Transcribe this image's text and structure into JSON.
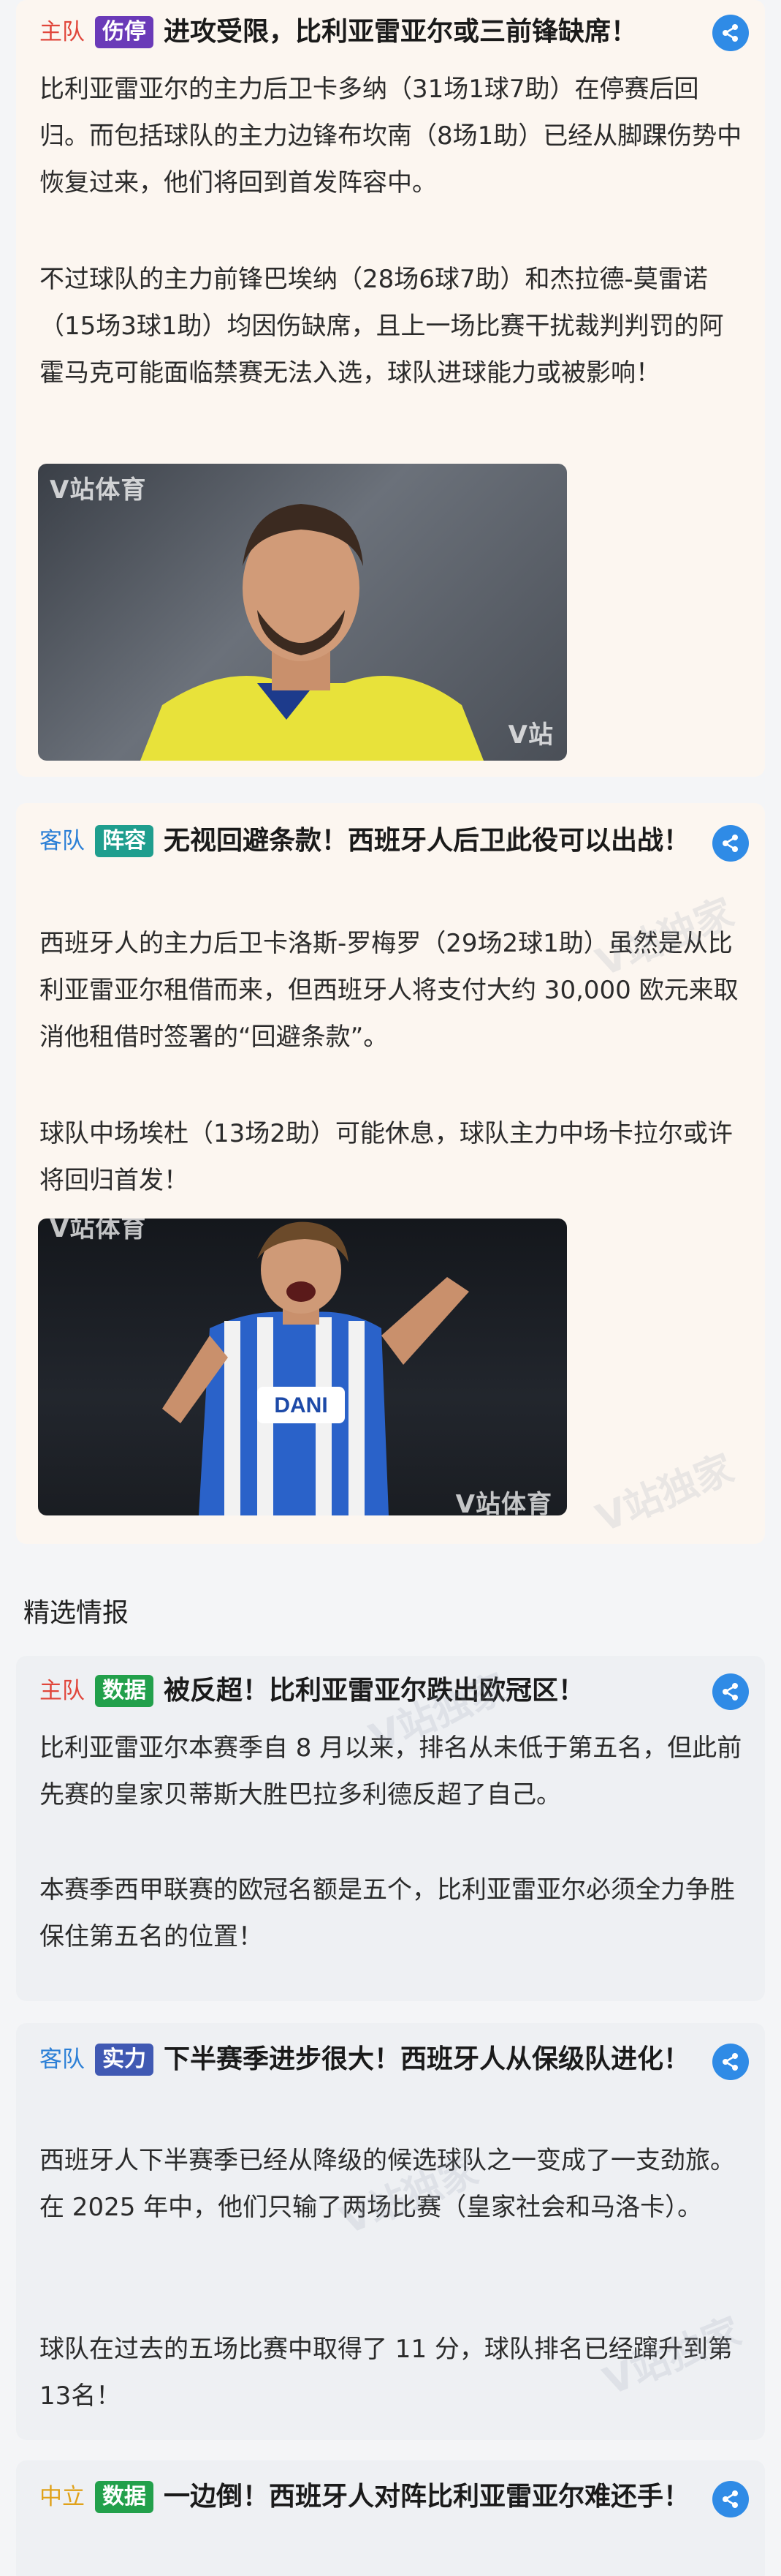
{
  "watermark": "V站独家",
  "cards": [
    {
      "team": "主队",
      "tag": "伤停",
      "title": "进攻受限，比利亚雷亚尔或三前锋缺席！",
      "paragraphs": [
        "比利亚雷亚尔的主力后卫卡多纳（31场1球7助）在停赛后回归。而包括球队的主力边锋布坎南（8场1助）已经从脚踝伤势中恢复过来，他们将回到首发阵容中。",
        "不过球队的主力前锋巴埃纳（28场6球7助）和杰拉德-莫雷诺（15场3球1助）均因伤缺席，且上一场比赛干扰裁判判罚的阿霍马克可能面临禁赛无法入选，球队进球能力或被影响！"
      ],
      "photo_watermarks": [
        "V站体育",
        "V站"
      ]
    },
    {
      "team": "客队",
      "tag": "阵容",
      "title": "无视回避条款！西班牙人后卫此役可以出战！",
      "paragraphs": [
        "西班牙人的主力后卫卡洛斯-罗梅罗（29场2球1助）虽然是从比利亚雷亚尔租借而来，但西班牙人将支付大约 30,000 欧元来取消他租借时签署的“回避条款”。",
        "球队中场埃杜（13场2助）可能休息，球队主力中场卡拉尔或许将回归首发！"
      ],
      "photo_watermarks": [
        "V站体育",
        "V站体育"
      ],
      "jersey_text": "DANI"
    }
  ],
  "section": {
    "title": "精选情报"
  },
  "intel": [
    {
      "team": "主队",
      "tag": "数据",
      "title": "被反超！比利亚雷亚尔跌出欧冠区！",
      "paragraphs": [
        "比利亚雷亚尔本赛季自 8 月以来，排名从未低于第五名，但此前先赛的皇家贝蒂斯大胜巴拉多利德反超了自己。",
        "本赛季西甲联赛的欧冠名额是五个，比利亚雷亚尔必须全力争胜保住第五名的位置！"
      ]
    },
    {
      "team": "客队",
      "tag": "实力",
      "title": "下半赛季进步很大！西班牙人从保级队进化！",
      "paragraphs": [
        "西班牙人下半赛季已经从降级的候选球队之一变成了一支劲旅。在 2025 年中，他们只输了两场比赛（皇家社会和马洛卡）。",
        "球队在过去的五场比赛中取得了 11 分，球队排名已经蹿升到第13名！"
      ]
    },
    {
      "team": "中立",
      "tag": "数据",
      "title": "一边倒！西班牙人对阵比利亚雷亚尔难还手！",
      "paragraphs": []
    }
  ],
  "colors": {
    "home": "#e0463b",
    "away": "#2b7fd6",
    "neutral": "#e0a21b",
    "share": "#2f8be6"
  }
}
